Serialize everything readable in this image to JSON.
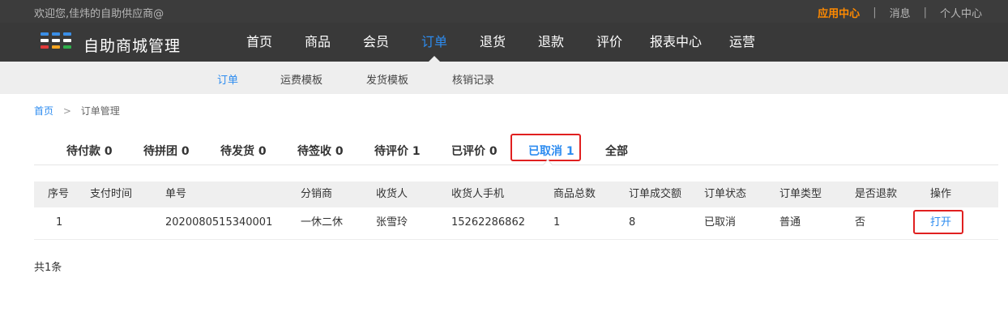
{
  "topbar": {
    "welcome": "欢迎您,佳炜的自助供应商@",
    "links": [
      "应用中心",
      "消息",
      "个人中心"
    ]
  },
  "header": {
    "brand": "自助商城管理",
    "logo_colors": [
      "#3a8ee6",
      "#3a8ee6",
      "#3a8ee6",
      "#ffffff",
      "#ffffff",
      "#ffffff",
      "#e23b3b",
      "#f5a623",
      "#2fae4b"
    ],
    "nav": [
      "首页",
      "商品",
      "会员",
      "订单",
      "退货",
      "退款",
      "评价",
      "报表中心",
      "运营"
    ],
    "active_nav": "订单"
  },
  "subnav": {
    "items": [
      "订单",
      "运费模板",
      "发货模板",
      "核销记录"
    ],
    "active": "订单"
  },
  "breadcrumb": {
    "home": "首页",
    "separator": ">",
    "current": "订单管理"
  },
  "tabs": {
    "items": [
      "待付款 0",
      "待拼团 0",
      "待发货 0",
      "待签收 0",
      "待评价 1",
      "已评价 0",
      "已取消 1",
      "全部"
    ],
    "active": "已取消 1"
  },
  "table": {
    "headers": [
      "序号",
      "支付时间",
      "单号",
      "分销商",
      "收货人",
      "收货人手机",
      "商品总数",
      "订单成交额",
      "订单状态",
      "订单类型",
      "是否退款",
      "操作"
    ],
    "rows": [
      [
        "1",
        "",
        "2020080515340001",
        "一休二休",
        "张雪玲",
        "15262286862",
        "1",
        "8",
        "已取消",
        "普通",
        "否",
        "打开"
      ]
    ]
  },
  "footer": {
    "total": "共1条"
  },
  "colors": {
    "accent": "#2d8cf0",
    "highlight": "#e02020",
    "top_active": "#ff8a00"
  }
}
